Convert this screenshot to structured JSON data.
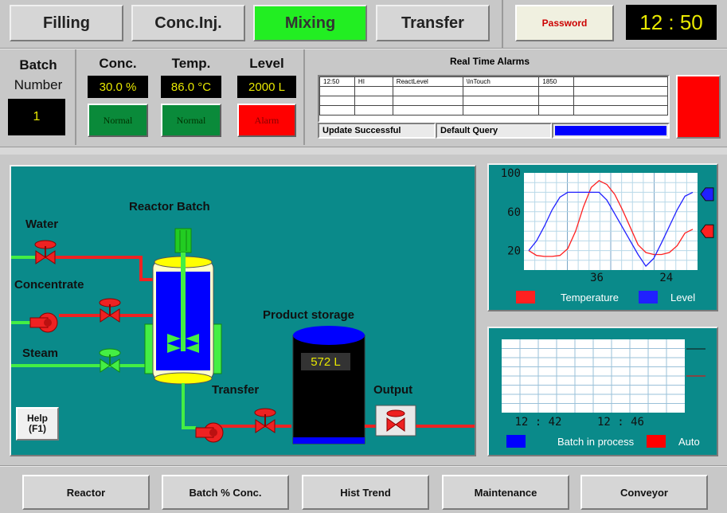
{
  "tabs": [
    {
      "label": "Filling"
    },
    {
      "label": "Conc.Inj."
    },
    {
      "label": "Mixing"
    },
    {
      "label": "Transfer"
    }
  ],
  "password_label": "Password",
  "clock": "12 : 50",
  "batch": {
    "title_line1": "Batch",
    "title_line2": "Number",
    "value": "1"
  },
  "readings": [
    {
      "label": "Conc.",
      "value": "30.0 %",
      "status": "Normal",
      "status_color": "#0a8a3a"
    },
    {
      "label": "Temp.",
      "value": "86.0 °C",
      "status": "Normal",
      "status_color": "#0a8a3a"
    },
    {
      "label": "Level",
      "value": "2000 L",
      "status": "Alarm",
      "status_color": "#ff0000"
    }
  ],
  "alarms": {
    "title": "Real Time Alarms",
    "rows": [
      [
        "12:50",
        "HI",
        "ReactLevel",
        "\\InTouch",
        "1850",
        ""
      ],
      [
        "",
        "",
        "",
        "",
        "",
        ""
      ],
      [
        "",
        "",
        "",
        "",
        "",
        ""
      ],
      [
        "",
        "",
        "",
        "",
        "",
        ""
      ]
    ],
    "status_text": "Update Successful",
    "query_text": "Default Query",
    "alarm_indicator_color": "#ff0000",
    "query_bar_color": "#0000ff"
  },
  "process": {
    "water_label": "Water",
    "concentrate_label": "Concentrate",
    "steam_label": "Steam",
    "reactor_label": "Reactor Batch",
    "storage_label": "Product storage",
    "storage_value": "572 L",
    "transfer_label": "Transfer",
    "output_label": "Output",
    "help_label_line1": "Help",
    "help_label_line2": "(F1)"
  },
  "chart_data": [
    {
      "type": "line",
      "y_ticks": [
        "100",
        "60",
        "20"
      ],
      "x_ticks": [
        "36",
        "24"
      ],
      "ylim": [
        0,
        100
      ],
      "series": [
        {
          "name": "Temperature",
          "color": "#ff2020",
          "values": [
            20,
            15,
            14,
            14,
            15,
            22,
            40,
            65,
            85,
            92,
            88,
            78,
            62,
            44,
            26,
            18,
            16,
            16,
            18,
            25,
            38,
            42
          ]
        },
        {
          "name": "Level",
          "color": "#2020ff",
          "values": [
            20,
            30,
            45,
            62,
            75,
            80,
            80,
            80,
            80,
            80,
            72,
            58,
            44,
            30,
            16,
            4,
            12,
            28,
            45,
            62,
            76,
            80
          ]
        }
      ],
      "indicators": [
        {
          "color": "#2020ff",
          "value": 78
        },
        {
          "color": "#ff2020",
          "value": 40
        }
      ]
    },
    {
      "type": "line",
      "x_ticks": [
        "12 : 42",
        "12 : 46"
      ],
      "ylim": [
        0,
        100
      ],
      "series": [
        {
          "name": "Batch in process",
          "color": "#0000ff",
          "values": []
        },
        {
          "name": "Auto",
          "color": "#ff0000",
          "values": []
        }
      ]
    }
  ],
  "bottom_buttons": [
    {
      "label": "Reactor"
    },
    {
      "label": "Batch % Conc."
    },
    {
      "label": "Hist Trend"
    },
    {
      "label": "Maintenance"
    },
    {
      "label": "Conveyor"
    }
  ]
}
